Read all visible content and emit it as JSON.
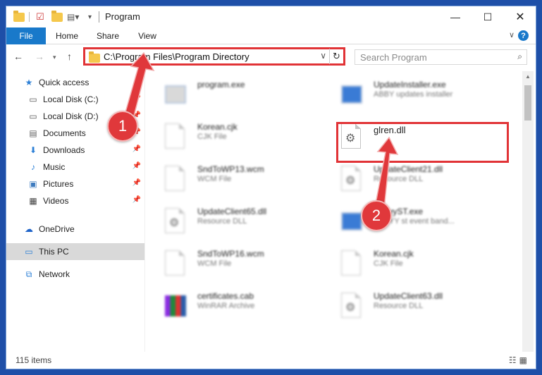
{
  "window": {
    "title": "Program"
  },
  "ribbon": {
    "tabs": [
      "File",
      "Home",
      "Share",
      "View"
    ],
    "help": "?"
  },
  "nav": {
    "address": "C:\\Program Files\\Program Directory",
    "search_placeholder": "Search Program"
  },
  "sidebar": {
    "items": [
      {
        "label": "Quick access",
        "icon": "star-icon"
      },
      {
        "label": "Local Disk (C:)",
        "icon": "drive-icon"
      },
      {
        "label": "Local Disk (D:)",
        "icon": "drive-icon"
      },
      {
        "label": "Documents",
        "icon": "documents-icon"
      },
      {
        "label": "Downloads",
        "icon": "download-icon"
      },
      {
        "label": "Music",
        "icon": "music-icon"
      },
      {
        "label": "Pictures",
        "icon": "pictures-icon"
      },
      {
        "label": "Videos",
        "icon": "videos-icon"
      },
      {
        "label": "OneDrive",
        "icon": "cloud-icon"
      },
      {
        "label": "This PC",
        "icon": "computer-icon"
      },
      {
        "label": "Network",
        "icon": "network-icon"
      }
    ]
  },
  "files": [
    {
      "name": "program.exe",
      "type": ""
    },
    {
      "name": "UpdateInstaller.exe",
      "type": "ABBY updates installer"
    },
    {
      "name": "Korean.cjk",
      "type": "CJK File"
    },
    {
      "name": "glren.dll",
      "type": ""
    },
    {
      "name": "SndToWP13.wcm",
      "type": "WCM File"
    },
    {
      "name": "UpdateClient21.dll",
      "type": "Resource DLL"
    },
    {
      "name": "UpdateClient65.dll",
      "type": "Resource DLL"
    },
    {
      "name": "AbbyyST.exe",
      "type": "ABBYY st event band..."
    },
    {
      "name": "SndToWP16.wcm",
      "type": "WCM File"
    },
    {
      "name": "Korean.cjk",
      "type": "CJK File"
    },
    {
      "name": "certificates.cab",
      "type": "WinRAR Archive"
    },
    {
      "name": "UpdateClient63.dll",
      "type": "Resource DLL"
    }
  ],
  "status": {
    "items": "115 items"
  },
  "steps": [
    "1",
    "2"
  ],
  "colors": {
    "accent": "#1979ca",
    "annotation": "#e13336",
    "desktop": "#1e4fa8"
  }
}
